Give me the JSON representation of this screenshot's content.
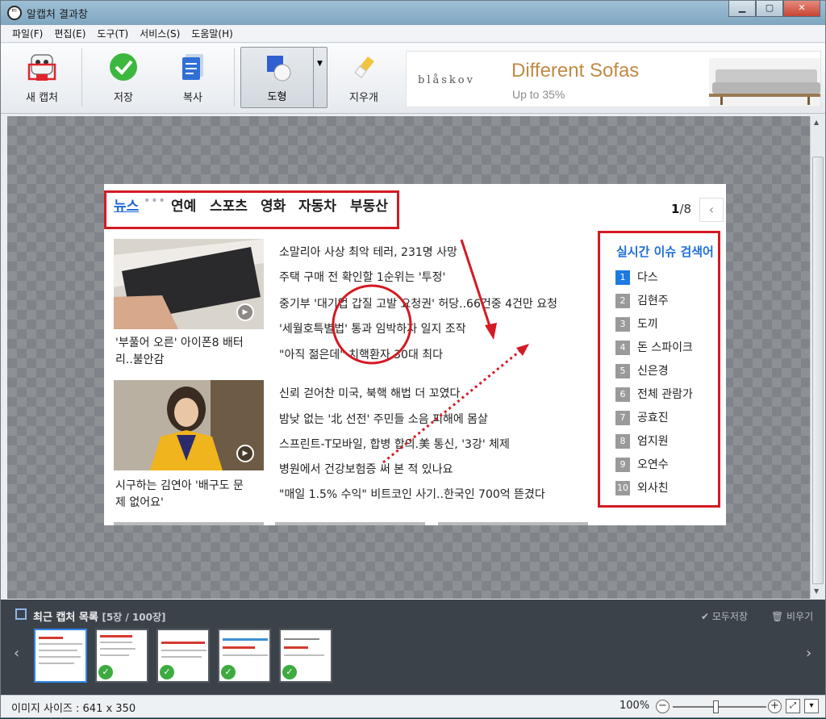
{
  "window": {
    "title": "알캡처 결과창",
    "app_icon_glyph": "ᄃ"
  },
  "menu": [
    "파일(F)",
    "편집(E)",
    "도구(T)",
    "서비스(S)",
    "도움말(H)"
  ],
  "toolbar": {
    "new_capture": "새 캡처",
    "save": "저장",
    "copy": "복사",
    "shape": "도형",
    "eraser": "지우개"
  },
  "ad": {
    "brand": "blåskov",
    "headline": "Different Sofas",
    "sub": "Up to 35%"
  },
  "capture": {
    "tabs": [
      "뉴스",
      "연예",
      "스포츠",
      "영화",
      "자동차",
      "부동산"
    ],
    "dots": "•••",
    "pager": {
      "current": "1",
      "total": "/8"
    },
    "prev_glyph": "‹",
    "stories": [
      {
        "caption": "'부풀어 오른' 아이폰8 배터리..불안감"
      },
      {
        "caption": "시구하는 김연아 '배구도 문제 없어요'"
      }
    ],
    "headlines": [
      "소말리아 사상 최악 테러, 231명 사망",
      "주택 구매 전 확인할 1순위는 '투정'",
      "중기부 '대기업 갑질 고발 요청권' 허당..66건중 4건만 요청",
      "'세월호특별법' 통과 임박하자 일지 조작",
      "\"아직 젊은데\" 치핵환자 30대 최다",
      "신뢰 걷어찬 미국, 북핵 해법 더 꼬였다",
      "밤낮 없는 '北 선전' 주민들 소음 피해에 몸살",
      "스프린트-T모바일, 합병 합의.美 통신, '3강' 체제",
      "병원에서 건강보험증 써 본 적 있나요",
      "\"매일 1.5% 수익\" 비트코인 사기..한국인 700억 뜯겼다"
    ],
    "ranking_title": "실시간 이슈 검색어",
    "ranking": [
      {
        "num": "1",
        "term": "다스"
      },
      {
        "num": "2",
        "term": "김현주"
      },
      {
        "num": "3",
        "term": "도끼"
      },
      {
        "num": "4",
        "term": "돈 스파이크"
      },
      {
        "num": "5",
        "term": "신은경"
      },
      {
        "num": "6",
        "term": "전체 관람가"
      },
      {
        "num": "7",
        "term": "공효진"
      },
      {
        "num": "8",
        "term": "엄지원"
      },
      {
        "num": "9",
        "term": "오연수"
      },
      {
        "num": "10",
        "term": "외사친"
      }
    ]
  },
  "recent": {
    "title": "최근 캡처 목록",
    "count": "[5장 / 100장]",
    "save_all": "✔ 모두저장",
    "clear": "🗑 비우기"
  },
  "status": {
    "image_size": "이미지 사이즈 : 641 x 350",
    "zoom": "100%"
  },
  "colors": {
    "annotation_red": "#d41a23",
    "accent_blue": "#1d67d3"
  }
}
